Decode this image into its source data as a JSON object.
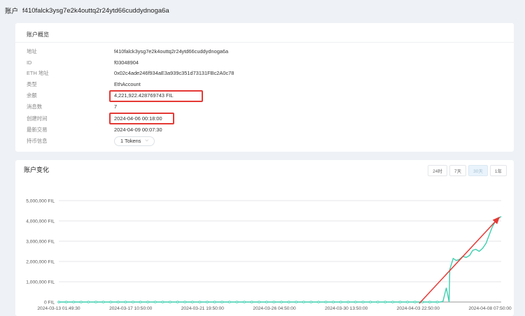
{
  "header": {
    "label": "账户",
    "address": "f410falck3ysg7e2k4outtq2r24ytd66cuddydnoga6a"
  },
  "overview": {
    "title": "账户概览",
    "rows": [
      {
        "label": "地址",
        "value": "f410falck3ysg7e2k4outtq2r24ytd66cuddydnoga6a"
      },
      {
        "label": "ID",
        "value": "f03048904"
      },
      {
        "label": "ETH 地址",
        "value": "0x02c4ade246f934aE3a939c351d73131FBc2A0c78"
      },
      {
        "label": "类型",
        "value": "EthAccount"
      },
      {
        "label": "余额",
        "value": "4,221,922.428769743 FIL"
      },
      {
        "label": "消息数",
        "value": "7"
      },
      {
        "label": "创建时间",
        "value": "2024-04-06 00:18:00"
      },
      {
        "label": "最新交易",
        "value": "2024-04-09 00:07:30"
      },
      {
        "label": "持币信息",
        "value": "1 Tokens"
      }
    ]
  },
  "chart_panel": {
    "title": "账户变化",
    "ranges": [
      "24时",
      "7天",
      "30天",
      "1年"
    ],
    "active_range": "30天"
  },
  "colors": {
    "line": "#3ecfae",
    "highlight": "#e53935",
    "arrow": "#e53935"
  },
  "chart_data": {
    "type": "line",
    "ylabel": "",
    "xlabel": "",
    "ylim": [
      0,
      5000000
    ],
    "y_ticks": [
      "0 FIL",
      "1,000,000 FIL",
      "2,000,000 FIL",
      "3,000,000 FIL",
      "4,000,000 FIL",
      "5,000,000 FIL"
    ],
    "x_tick_labels": [
      "2024-03-13 01:49:30",
      "2024-03-17 10:50:00",
      "2024-03-21 19:50:00",
      "2024-03-26 04:50:00",
      "2024-03-30 13:50:00",
      "2024-04-03 22:50:00",
      "2024-04-08 07:50:00"
    ],
    "x_range": [
      "2024-03-13 01:49:30",
      "2024-04-09 00:07:30"
    ],
    "grid": true,
    "series": [
      {
        "values_days": [
          0,
          3,
          6,
          9,
          12,
          15,
          18,
          21,
          24,
          23.2,
          23.4,
          23.6,
          23.8,
          24.0,
          24.2,
          24.4,
          24.6,
          24.8,
          25.0,
          25.2,
          25.4,
          25.6,
          25.8,
          26.0,
          26.2,
          26.4,
          26.6,
          26.9
        ],
        "x": [
          "2024-03-13 01:49:30",
          "2024-03-16 01:49:30",
          "2024-03-19 01:49:30",
          "2024-03-22 01:49:30",
          "2024-03-25 01:49:30",
          "2024-03-28 01:49:30",
          "2024-03-31 01:49:30",
          "2024-04-03 01:49:30",
          "2024-04-05 20:00:00",
          "2024-04-05 06:30:00",
          "2024-04-05 11:00:00",
          "2024-04-05 16:00:00",
          "2024-04-05 21:00:00",
          "2024-04-06 02:00:00",
          "2024-04-06 06:30:00",
          "2024-04-06 11:00:00",
          "2024-04-06 16:00:00",
          "2024-04-06 21:00:00",
          "2024-04-07 02:00:00",
          "2024-04-07 06:30:00",
          "2024-04-07 11:00:00",
          "2024-04-07 16:00:00",
          "2024-04-07 21:00:00",
          "2024-04-08 02:00:00",
          "2024-04-08 06:30:00",
          "2024-04-08 11:00:00",
          "2024-04-08 16:00:00",
          "2024-04-09 00:07:30"
        ],
        "values": [
          0,
          0,
          0,
          0,
          0,
          0,
          0,
          0,
          0,
          0,
          30000,
          700000,
          1600000,
          2150000,
          2050000,
          2100000,
          2250000,
          2200000,
          2300000,
          2550000,
          2600000,
          2500000,
          2650000,
          2900000,
          3300000,
          3700000,
          4000000,
          4221922
        ]
      }
    ]
  }
}
